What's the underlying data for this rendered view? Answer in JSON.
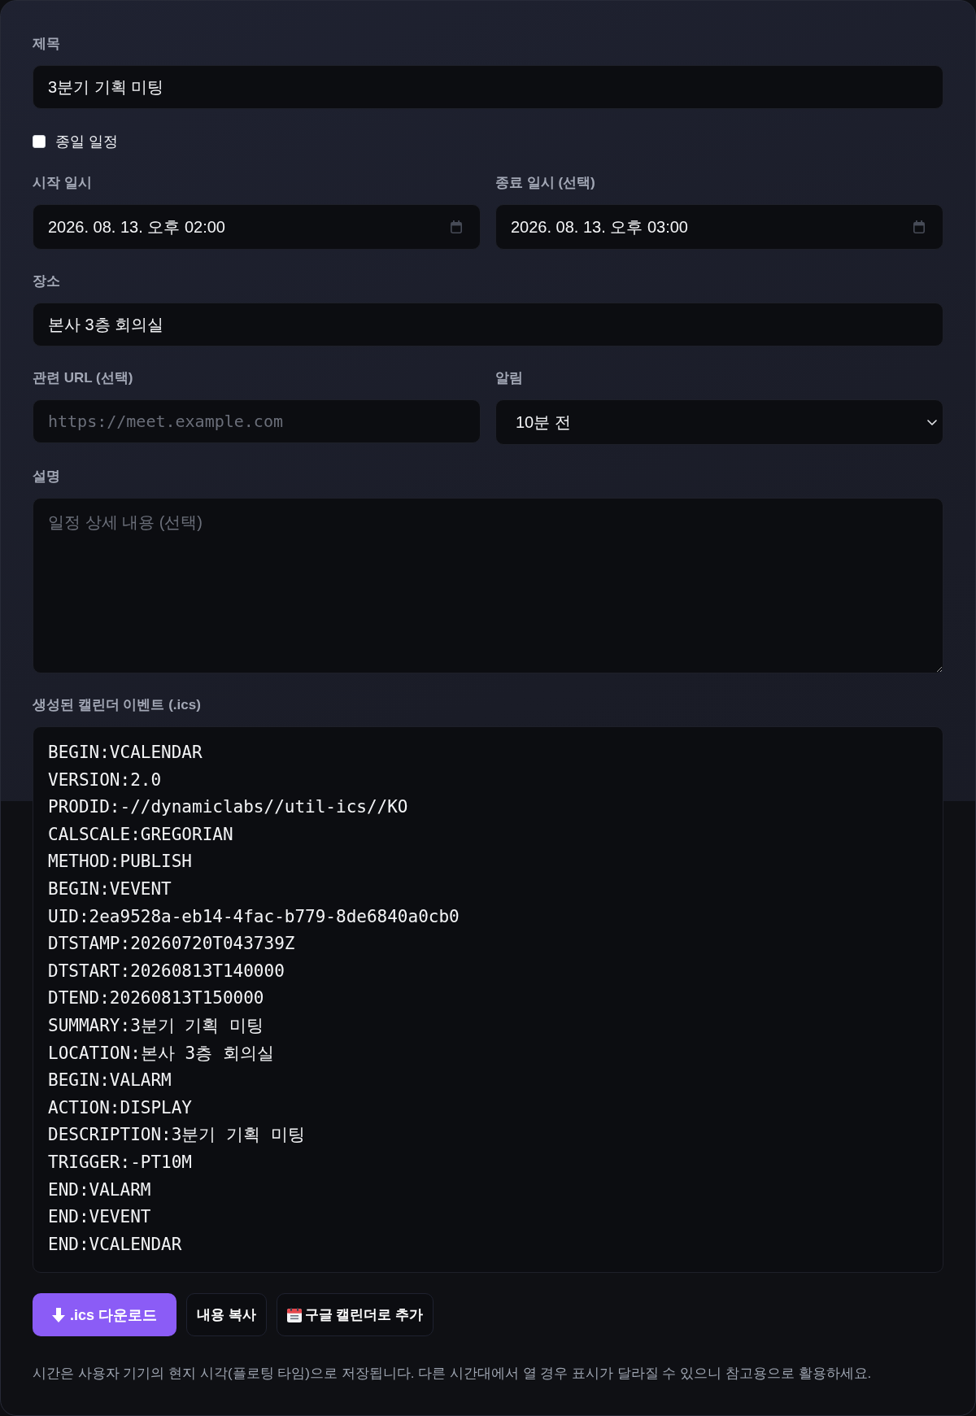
{
  "form": {
    "items": [
      {
        "kind": "text",
        "label": "제목",
        "value": "3분기 기획 미팅"
      },
      {
        "kind": "checkbox",
        "label": "종일 일정",
        "checked": false
      },
      {
        "kind": "pair",
        "fields": [
          {
            "kind": "datetime",
            "label": "시작 일시",
            "value": "2026. 08. 13. 오후 02:00"
          },
          {
            "kind": "datetime",
            "label": "종료 일시 (선택)",
            "value": "2026. 08. 13. 오후 03:00"
          }
        ]
      },
      {
        "kind": "text",
        "label": "장소",
        "value": "본사 3층 회의실"
      },
      {
        "kind": "pair",
        "fields": [
          {
            "kind": "url",
            "label": "관련 URL (선택)",
            "placeholder": "https://meet.example.com"
          },
          {
            "kind": "select",
            "label": "알림",
            "value": "10분 전"
          }
        ]
      },
      {
        "kind": "textarea",
        "label": "설명",
        "placeholder": "일정 상세 내용 (선택)"
      }
    ]
  },
  "ics_output": {
    "label": "생성된 캘린더 이벤트 (.ics)",
    "lines": [
      "BEGIN:VCALENDAR",
      "VERSION:2.0",
      "PRODID:-//dynamiclabs//util-ics//KO",
      "CALSCALE:GREGORIAN",
      "METHOD:PUBLISH",
      "BEGIN:VEVENT",
      "UID:2ea9528a-eb14-4fac-b779-8de6840a0cb0",
      "DTSTAMP:20260720T043739Z",
      "DTSTART:20260813T140000",
      "DTEND:20260813T150000",
      "SUMMARY:3분기 기획 미팅",
      "LOCATION:본사 3층 회의실",
      "BEGIN:VALARM",
      "ACTION:DISPLAY",
      "DESCRIPTION:3분기 기획 미팅",
      "TRIGGER:-PT10M",
      "END:VALARM",
      "END:VEVENT",
      "END:VCALENDAR"
    ]
  },
  "buttons": [
    {
      "kind": "download",
      "label": ".ics 다운로드"
    },
    {
      "kind": "copy",
      "label": "내용 복사"
    },
    {
      "kind": "calendar",
      "label": "구글 캘린더로 추가"
    }
  ],
  "note": "시간은 사용자 기기의 현지 시각(플로팅 타임)으로 저장됩니다. 다른 시간대에서 열 경우 표시가 달라질 수 있으니 참고용으로 활용하세요."
}
